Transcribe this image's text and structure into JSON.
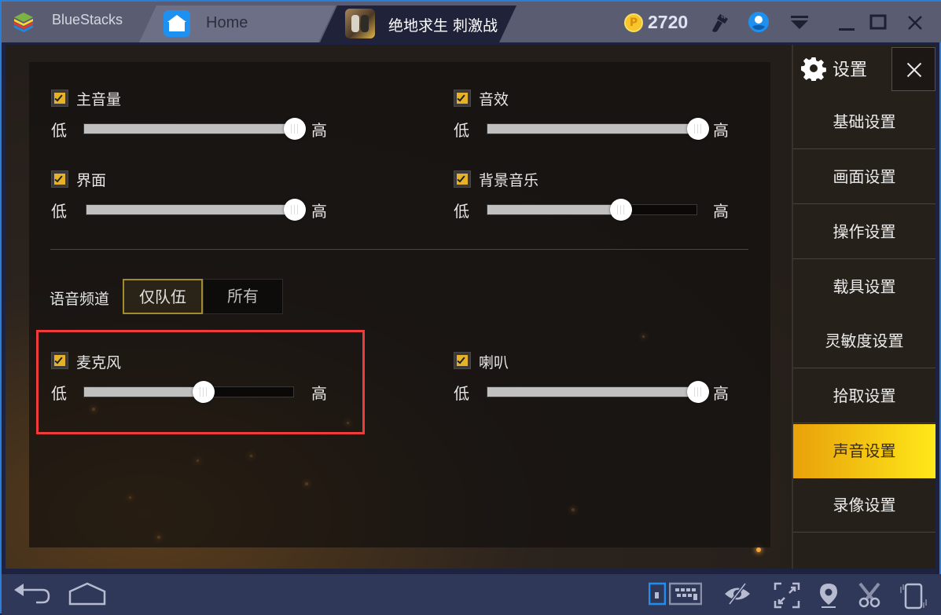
{
  "window": {
    "app_name": "BlueStacks",
    "tabs": [
      {
        "label": "Home",
        "icon": "home-icon"
      },
      {
        "label": "绝地求生 刺激战场",
        "icon": "game-icon",
        "active": true
      }
    ],
    "coins": "2720",
    "toolbar_icons": [
      "brush-icon",
      "user-icon",
      "menu-icon",
      "minimize-icon",
      "maximize-icon",
      "close-icon"
    ]
  },
  "settings": {
    "title": "设置",
    "close_icon": "close-icon",
    "menu": [
      {
        "label": "基础设置",
        "active": false
      },
      {
        "label": "画面设置",
        "active": false
      },
      {
        "label": "操作设置",
        "active": false
      },
      {
        "label": "载具设置",
        "active": false
      },
      {
        "label": "灵敏度设置",
        "active": false
      },
      {
        "label": "拾取设置",
        "active": false
      },
      {
        "label": "声音设置",
        "active": true
      },
      {
        "label": "录像设置",
        "active": false
      }
    ],
    "low_label": "低",
    "high_label": "高",
    "sliders": [
      {
        "key": "master",
        "label": "主音量",
        "checked": true,
        "value": 1.0
      },
      {
        "key": "sfx",
        "label": "音效",
        "checked": true,
        "value": 1.0
      },
      {
        "key": "ui",
        "label": "界面",
        "checked": true,
        "value": 1.0
      },
      {
        "key": "bgm",
        "label": "背景音乐",
        "checked": true,
        "value": 0.64
      },
      {
        "key": "mic",
        "label": "麦克风",
        "checked": true,
        "value": 0.57
      },
      {
        "key": "speaker",
        "label": "喇叭",
        "checked": true,
        "value": 1.0
      }
    ],
    "voice_channel": {
      "label": "语音频道",
      "options": [
        "仅队伍",
        "所有"
      ],
      "selected": "仅队伍"
    }
  },
  "bottom_bar": {
    "left_icons": [
      "back-icon",
      "home-icon"
    ],
    "right_icons": [
      "keyboard-toggle-icon",
      "keymap-icon",
      "hide-icon",
      "fullscreen-icon",
      "location-icon",
      "screenshot-scissors-icon",
      "rotate-device-icon"
    ]
  },
  "colors": {
    "accent_active": "#ffe81a",
    "highlight_box": "#ef3b3b",
    "checkbox": "#e6b22a",
    "bluestacks_frame": "#2a7fd4"
  }
}
